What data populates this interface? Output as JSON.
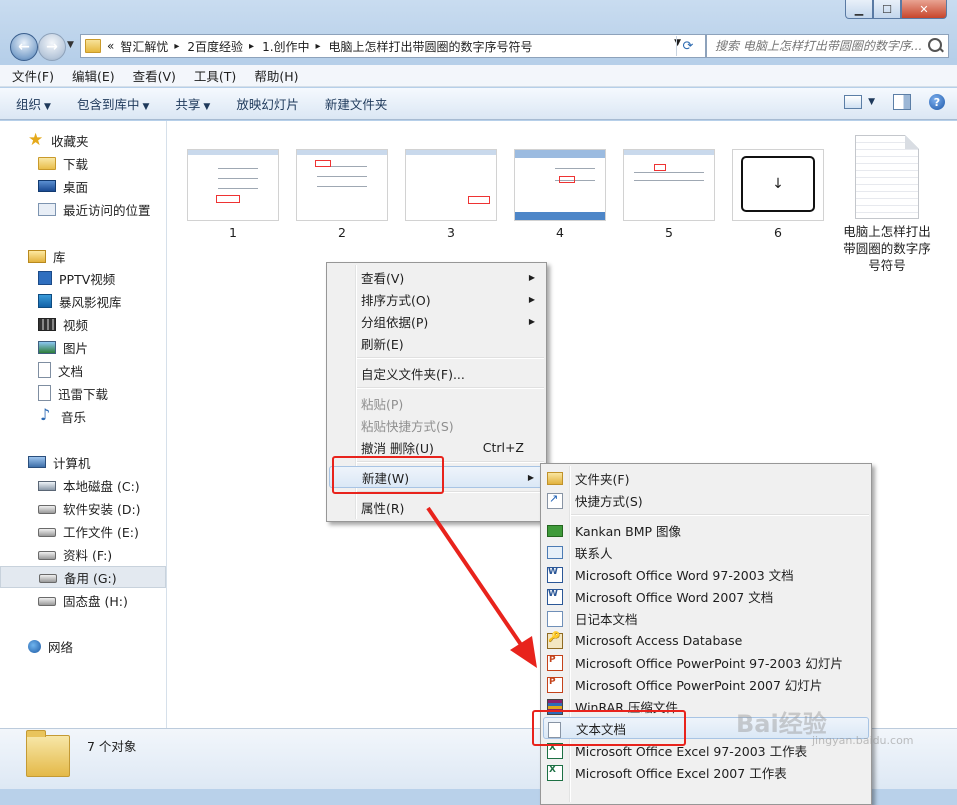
{
  "window": {
    "minimize": "▁",
    "maximize": "☐",
    "close": "✕"
  },
  "address": {
    "prefix": "«",
    "segments": [
      "智汇解忧",
      "2百度经验",
      "1.创作中",
      "电脑上怎样打出带圆圈的数字序号符号"
    ],
    "separator": "▸",
    "search_placeholder": "搜索 电脑上怎样打出带圆圈的数字序..."
  },
  "menubar": [
    "文件(F)",
    "编辑(E)",
    "查看(V)",
    "工具(T)",
    "帮助(H)"
  ],
  "commands": [
    {
      "label": "组织",
      "dropdown": true
    },
    {
      "label": "包含到库中",
      "dropdown": true
    },
    {
      "label": "共享",
      "dropdown": true
    },
    {
      "label": "放映幻灯片",
      "dropdown": false
    },
    {
      "label": "新建文件夹",
      "dropdown": false
    }
  ],
  "nav": {
    "favorites": {
      "label": "收藏夹",
      "items": [
        "下载",
        "桌面",
        "最近访问的位置"
      ]
    },
    "libraries": {
      "label": "库",
      "items": [
        "PPTV视频",
        "暴风影视库",
        "视频",
        "图片",
        "文档",
        "迅雷下载",
        "音乐"
      ]
    },
    "computer": {
      "label": "计算机",
      "items": [
        "本地磁盘 (C:)",
        "软件安装 (D:)",
        "工作文件 (E:)",
        "资料 (F:)",
        "备用 (G:)",
        "固态盘 (H:)"
      ],
      "selected": "备用 (G:)"
    },
    "network": {
      "label": "网络"
    }
  },
  "files": [
    {
      "name": "1",
      "icon": "screenshot-thumbnail"
    },
    {
      "name": "2",
      "icon": "screenshot-thumbnail"
    },
    {
      "name": "3",
      "icon": "screenshot-thumbnail"
    },
    {
      "name": "4",
      "icon": "screenshot-thumbnail"
    },
    {
      "name": "5",
      "icon": "screenshot-thumbnail"
    },
    {
      "name": "6",
      "icon": "key-thumbnail",
      "glyph": "↓"
    },
    {
      "name": "电脑上怎样打出带圆圈的数字序号符号",
      "icon": "text-file-icon"
    }
  ],
  "status": {
    "count_text": "7 个对象"
  },
  "context_menu": {
    "items": [
      {
        "label": "查看(V)",
        "submenu": true
      },
      {
        "label": "排序方式(O)",
        "submenu": true
      },
      {
        "label": "分组依据(P)",
        "submenu": true
      },
      {
        "label": "刷新(E)"
      },
      {
        "label": "自定义文件夹(F)..."
      },
      {
        "label": "粘贴(P)",
        "disabled": true
      },
      {
        "label": "粘贴快捷方式(S)",
        "disabled": true
      },
      {
        "label": "撤消 删除(U)",
        "shortcut": "Ctrl+Z"
      },
      {
        "label": "新建(W)",
        "submenu": true,
        "highlighted": true
      },
      {
        "label": "属性(R)"
      }
    ]
  },
  "new_submenu": {
    "items": [
      {
        "label": "文件夹(F)",
        "icon": "folder-icon"
      },
      {
        "label": "快捷方式(S)",
        "icon": "shortcut-icon"
      },
      {
        "label": "Kankan BMP 图像",
        "icon": "bmp-icon"
      },
      {
        "label": "联系人",
        "icon": "contact-icon"
      },
      {
        "label": "Microsoft Office Word 97-2003 文档",
        "icon": "word-icon"
      },
      {
        "label": "Microsoft Office Word 2007 文档",
        "icon": "word-icon"
      },
      {
        "label": "日记本文档",
        "icon": "journal-icon"
      },
      {
        "label": "Microsoft Access Database",
        "icon": "access-icon"
      },
      {
        "label": "Microsoft Office PowerPoint 97-2003 幻灯片",
        "icon": "powerpoint-icon"
      },
      {
        "label": "Microsoft Office PowerPoint 2007 幻灯片",
        "icon": "powerpoint-icon"
      },
      {
        "label": "WinRAR 压缩文件",
        "icon": "winrar-icon"
      },
      {
        "label": "文本文档",
        "icon": "text-document-icon",
        "highlighted": true
      },
      {
        "label": "Microsoft Office Excel 97-2003 工作表",
        "icon": "excel-icon"
      },
      {
        "label": "Microsoft Office Excel 2007 工作表",
        "icon": "excel-icon"
      }
    ]
  },
  "annotation": {
    "color": "#e8231c"
  },
  "watermark": {
    "text": "Bai经验",
    "url": "jingyan.baidu.com"
  }
}
